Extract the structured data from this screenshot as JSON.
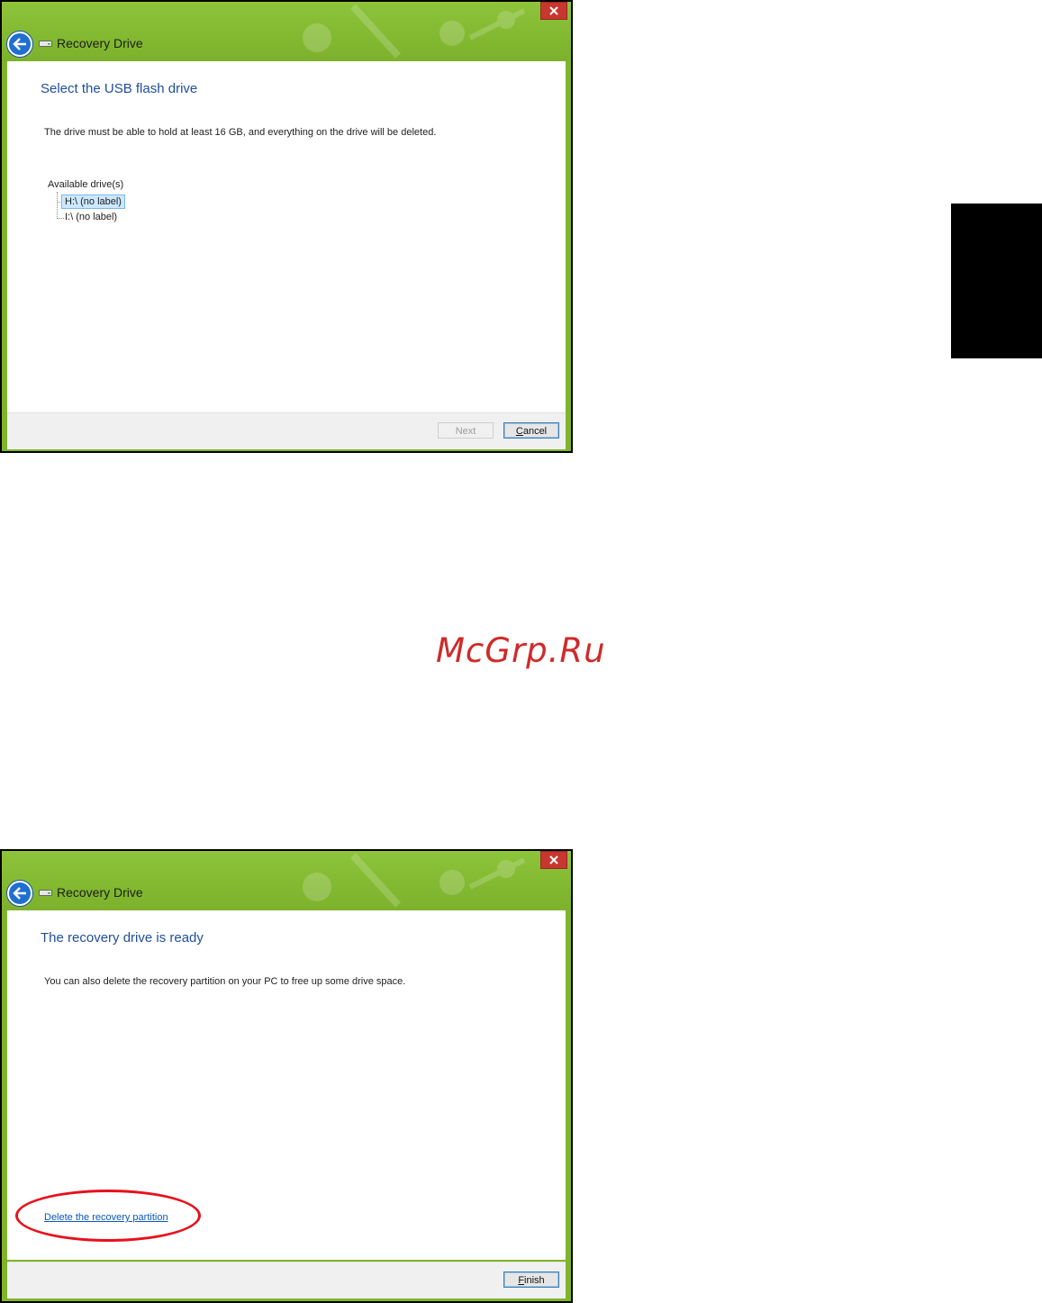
{
  "dialog1": {
    "title": "Recovery Drive",
    "heading": "Select the USB flash drive",
    "description": "The drive must be able to hold at least 16 GB, and everything on the drive will be deleted.",
    "drives_label": "Available drive(s)",
    "drives": [
      {
        "label": "H:\\ (no label)",
        "selected": true
      },
      {
        "label": "I:\\ (no label)",
        "selected": false
      }
    ],
    "buttons": {
      "next": "Next",
      "cancel": "Cancel"
    }
  },
  "dialog2": {
    "title": "Recovery Drive",
    "heading": "The recovery drive is ready",
    "description": "You can also delete the recovery partition on your PC to free up some drive space.",
    "link": "Delete the recovery partition",
    "buttons": {
      "finish": "Finish"
    }
  },
  "watermark": "McGrp.Ru",
  "colors": {
    "titlebar_green": "#7fb52a",
    "heading_blue": "#1f4e9c",
    "close_red": "#c7372f",
    "highlight_ellipse": "#e8101b"
  },
  "icons": [
    "close-icon",
    "back-arrow-icon",
    "drive-icon"
  ]
}
